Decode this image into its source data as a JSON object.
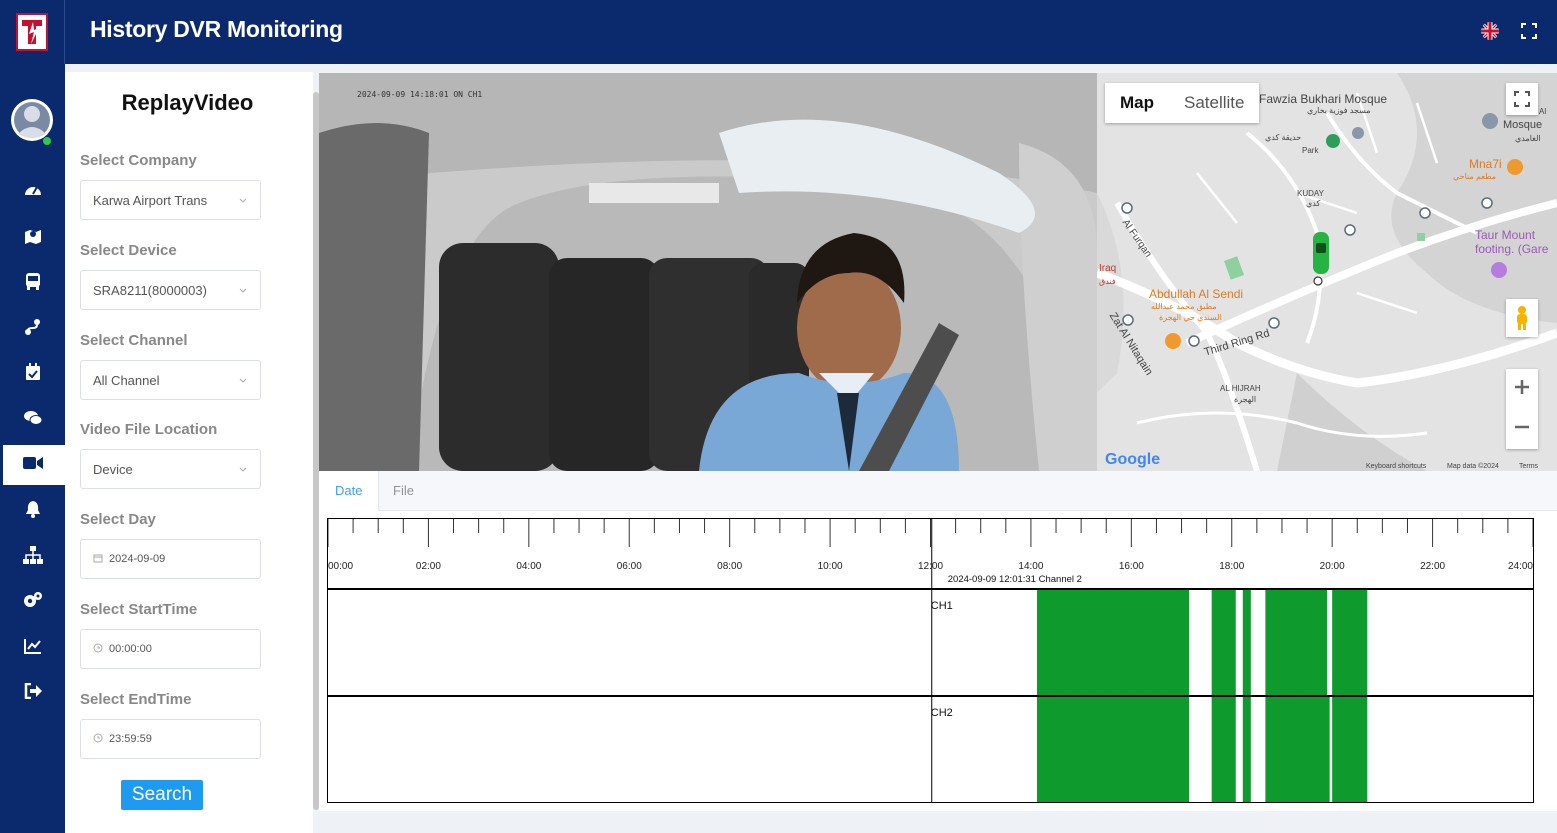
{
  "header": {
    "title": "History DVR Monitoring",
    "language_icon": "uk-flag-icon",
    "fullscreen_icon": "fullscreen-icon"
  },
  "sidebar": {
    "items": [
      {
        "name": "dashboard",
        "icon": "dashboard-icon"
      },
      {
        "name": "map",
        "icon": "map-icon"
      },
      {
        "name": "vehicles",
        "icon": "bus-icon"
      },
      {
        "name": "routes",
        "icon": "route-icon"
      },
      {
        "name": "schedule",
        "icon": "calendar-check-icon"
      },
      {
        "name": "messages",
        "icon": "comments-icon"
      },
      {
        "name": "video",
        "icon": "video-icon",
        "active": true
      },
      {
        "name": "alerts",
        "icon": "bell-icon"
      },
      {
        "name": "organization",
        "icon": "sitemap-icon"
      },
      {
        "name": "settings",
        "icon": "cogs-icon"
      },
      {
        "name": "reports",
        "icon": "chart-icon"
      },
      {
        "name": "logout",
        "icon": "logout-icon"
      }
    ]
  },
  "panel": {
    "title": "ReplayVideo",
    "company_label": "Select Company",
    "company_value": "Karwa Airport Trans",
    "device_label": "Select Device",
    "device_value": "SRA8211(8000003)",
    "channel_label": "Select Channel",
    "channel_value": "All Channel",
    "location_label": "Video File Location",
    "location_value": "Device",
    "day_label": "Select Day",
    "day_value": "2024-09-09",
    "start_label": "Select StartTime",
    "start_value": "00:00:00",
    "end_label": "Select EndTime",
    "end_value": "23:59:59",
    "search_label": "Search"
  },
  "video": {
    "overlay": "2024-09-09 14:18:01  ON  CH1"
  },
  "map": {
    "tab_map": "Map",
    "tab_satellite": "Satellite",
    "labels": {
      "mosque": "Fawzia Bukhari Mosque",
      "mosque_ar": "مسجد فوزية بخاري",
      "park": "Park",
      "park_ar": "حديقة كدي",
      "kuday": "KUDAY",
      "kuday_ar": "كدي",
      "mna7i": "Mna7i",
      "mna7i_ar": "مطعم مناحي",
      "taur1": "Taur Mount",
      "taur2": "footing. (Gare",
      "mosque_right1": "Al",
      "mosque_right2": "Mosque",
      "mosque_right_ar": "الغامدي",
      "al_furqan": "Al Furqan",
      "abdullah": "Abdullah Al Sendi",
      "abdullah_ar1": "مطبق محمد عبدالله",
      "abdullah_ar2": "السندي حي الهجرة",
      "zat": "Zat Al Nitaqain",
      "third_ring": "Third Ring Rd",
      "hijrah": "AL HIJRAH",
      "hijrah_ar": "الهجرة",
      "iraq": "Iraq",
      "iraq_ar": "فندق",
      "google": "Google",
      "shortcuts": "Keyboard shortcuts",
      "mapdata": "Map data ©2024",
      "terms": "Terms"
    }
  },
  "bottom": {
    "tab_date": "Date",
    "tab_file": "File",
    "ticks": [
      "00:00",
      "02:00",
      "04:00",
      "06:00",
      "08:00",
      "10:00",
      "12:00",
      "14:00",
      "16:00",
      "18:00",
      "20:00",
      "22:00",
      "24:00"
    ],
    "cursor_label": "2024-09-09 12:01:31  Channel 2",
    "cursor_hour": 12.025,
    "channels": [
      {
        "name": "CH1",
        "segments": [
          [
            14.12,
            17.15
          ],
          [
            17.6,
            18.08
          ],
          [
            18.22,
            18.38
          ],
          [
            18.67,
            19.9
          ],
          [
            20.0,
            20.7
          ]
        ]
      },
      {
        "name": "CH2",
        "segments": [
          [
            14.12,
            17.15
          ],
          [
            17.6,
            18.08
          ],
          [
            18.22,
            18.38
          ],
          [
            18.67,
            19.95
          ],
          [
            20.0,
            20.7
          ]
        ]
      }
    ]
  }
}
